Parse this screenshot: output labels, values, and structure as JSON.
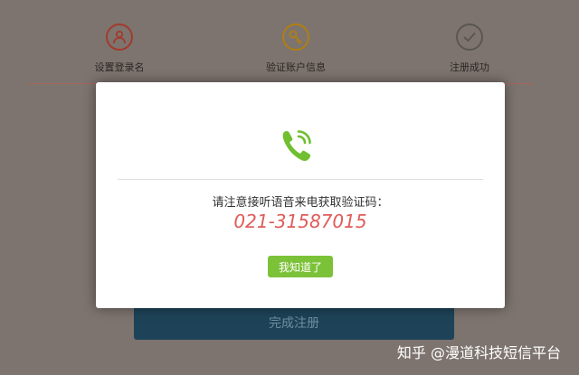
{
  "steps": [
    {
      "label": "设置登录名",
      "icon": "user-icon",
      "color": "#a33a2c"
    },
    {
      "label": "验证账户信息",
      "icon": "key-icon",
      "color": "#b07f12"
    },
    {
      "label": "注册成功",
      "icon": "checkmark-icon",
      "color": "#5b5653"
    }
  ],
  "submit": {
    "label": "完成注册"
  },
  "modal": {
    "icon": "phone-call-icon",
    "prompt": "请注意接听语音来电获取验证码：",
    "phone_number": "021-31587015",
    "ok_label": "我知道了"
  },
  "watermark": {
    "text": "知乎 @漫道科技短信平台"
  },
  "colors": {
    "overlay": "#7d746f",
    "accent_green": "#7cc239",
    "number_red": "#e05b59",
    "submit_bg": "#1e4358"
  }
}
